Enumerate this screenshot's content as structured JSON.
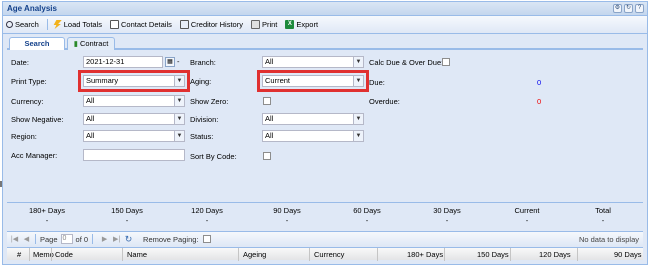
{
  "window": {
    "title": "Age Analysis"
  },
  "toolbar": {
    "search": "Search",
    "load_totals": "Load Totals",
    "contact_details": "Contact Details",
    "creditor_history": "Creditor History",
    "print": "Print",
    "export": "Export"
  },
  "tabs": [
    {
      "label": "Search",
      "active": true
    },
    {
      "label": "Contract",
      "active": false
    }
  ],
  "form": {
    "date_label": "Date:",
    "date_value": "2021-12-31",
    "print_type_label": "Print Type:",
    "print_type_value": "Summary",
    "currency_label": "Currency:",
    "currency_value": "All",
    "show_negative_label": "Show Negative:",
    "show_negative_value": "All",
    "region_label": "Region:",
    "region_value": "All",
    "acc_manager_label": "Acc Manager:",
    "acc_manager_value": "",
    "branch_label": "Branch:",
    "branch_value": "All",
    "aging_label": "Aging:",
    "aging_value": "Current",
    "show_zero_label": "Show Zero:",
    "division_label": "Division:",
    "division_value": "All",
    "status_label": "Status:",
    "status_value": "All",
    "sort_by_code_label": "Sort By Code:",
    "calc_due_label": "Calc Due & Over Due:",
    "due_label": "Due:",
    "due_value": "0",
    "overdue_label": "Overdue:",
    "overdue_value": "0"
  },
  "summary": [
    {
      "label": "180+ Days",
      "value": "-"
    },
    {
      "label": "150 Days",
      "value": "-"
    },
    {
      "label": "120 Days",
      "value": "-"
    },
    {
      "label": "90 Days",
      "value": "-"
    },
    {
      "label": "60 Days",
      "value": "-"
    },
    {
      "label": "30 Days",
      "value": "-"
    },
    {
      "label": "Current",
      "value": "-"
    },
    {
      "label": "Total",
      "value": "-"
    }
  ],
  "pager": {
    "page_label": "Page",
    "page_value": "0",
    "of_label": "of 0",
    "remove_paging_label": "Remove Paging:",
    "no_data": "No data to display"
  },
  "grid_columns": [
    "#",
    "Memo",
    "Code",
    "Name",
    "Ageing",
    "Currency",
    "180+ Days",
    "150 Days",
    "120 Days",
    "90 Days"
  ],
  "colors": {
    "highlight": "#e03030",
    "due": "#0000ee",
    "overdue": "#ee0000"
  }
}
